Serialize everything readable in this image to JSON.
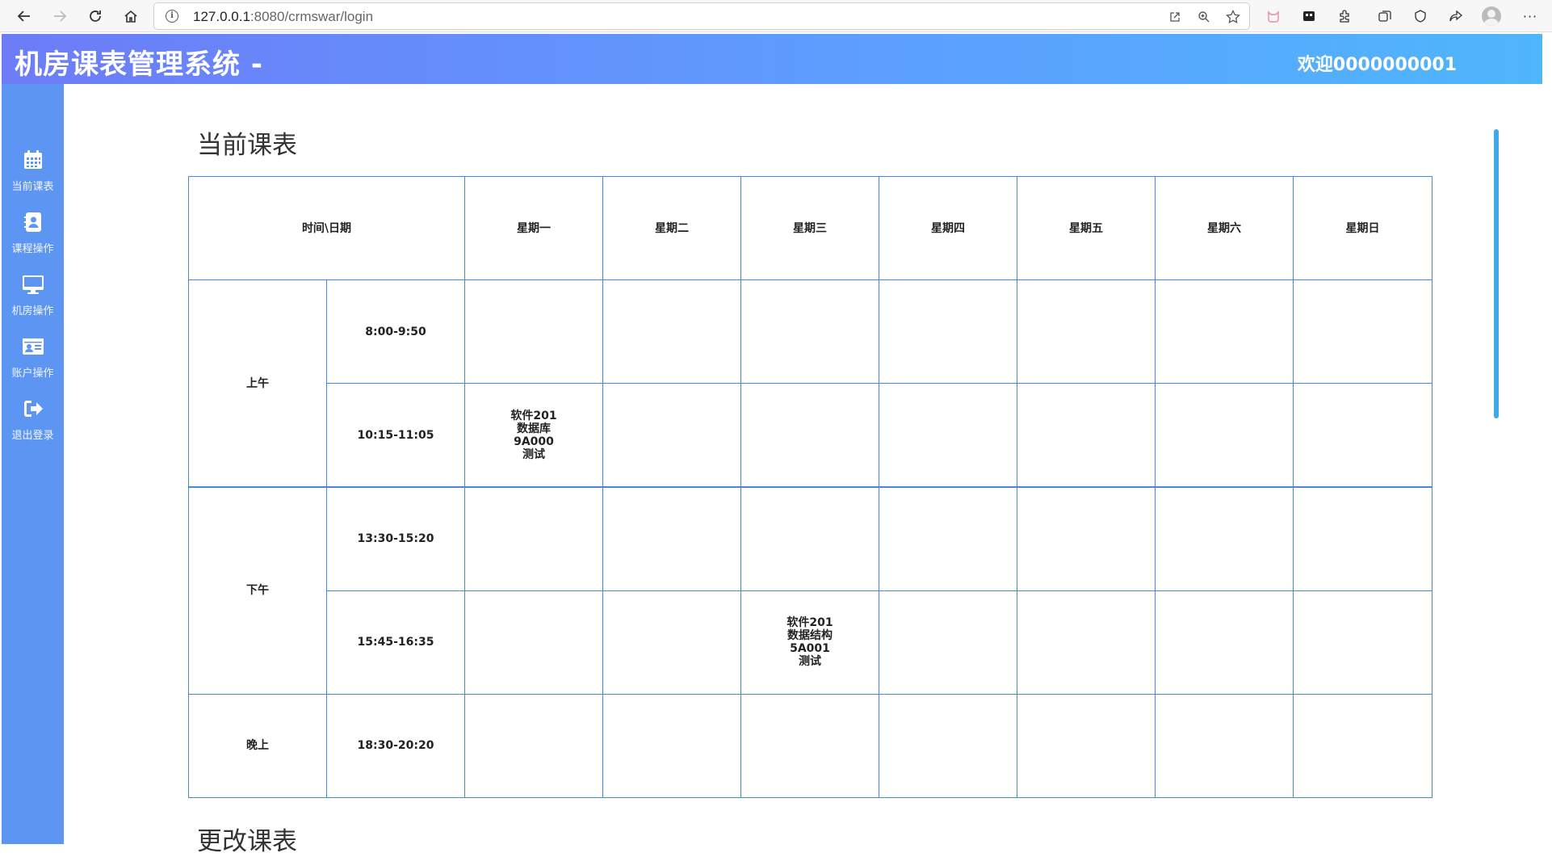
{
  "browser": {
    "url_host": "127.0.0.1",
    "url_rest": ":8080/crmswar/login"
  },
  "header": {
    "title": "机房课表管理系统 -",
    "welcome": "欢迎0000000001"
  },
  "sidebar": {
    "items": [
      {
        "label": "当前课表",
        "icon": "calendar-icon"
      },
      {
        "label": "课程操作",
        "icon": "contact-book-icon"
      },
      {
        "label": "机房操作",
        "icon": "monitor-icon"
      },
      {
        "label": "账户操作",
        "icon": "id-card-icon"
      },
      {
        "label": "退出登录",
        "icon": "sign-out-icon"
      }
    ]
  },
  "main": {
    "current_title": "当前课表",
    "change_title": "更改课表"
  },
  "timetable": {
    "corner": "时间\\日期",
    "days": [
      "星期一",
      "星期二",
      "星期三",
      "星期四",
      "星期五",
      "星期六",
      "星期日"
    ],
    "periods": [
      {
        "label": "上午",
        "slots": [
          "8:00-9:50",
          "10:15-11:05"
        ]
      },
      {
        "label": "下午",
        "slots": [
          "13:30-15:20",
          "15:45-16:35"
        ]
      },
      {
        "label": "晚上",
        "slots": [
          "18:30-20:20"
        ]
      }
    ],
    "course_1": {
      "class": "软件201",
      "course": "数据库",
      "room": "9A000",
      "teacher": "测试"
    },
    "course_2": {
      "class": "软件201",
      "course": "数据结构",
      "room": "5A001",
      "teacher": "测试"
    }
  },
  "colors": {
    "header_start": "#6d7cf7",
    "header_end": "#4fb6fb",
    "sidebar": "#5d96f2",
    "table_border": "#4a86df"
  }
}
